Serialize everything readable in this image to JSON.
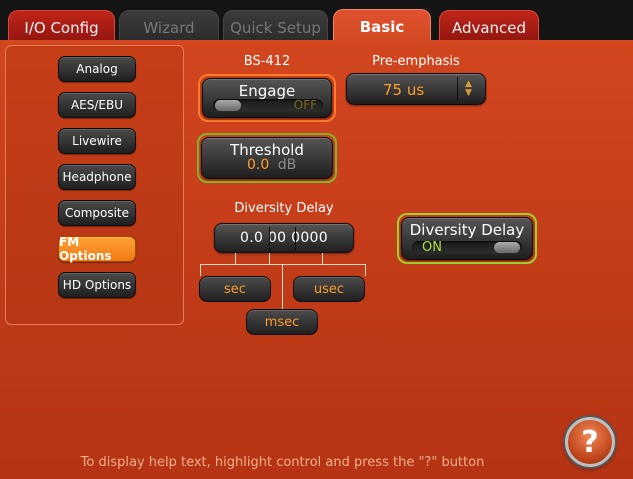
{
  "tabs": [
    {
      "label": "I/O Config",
      "state": "normal"
    },
    {
      "label": "Wizard",
      "state": "disabled"
    },
    {
      "label": "Quick Setup",
      "state": "disabled"
    },
    {
      "label": "Basic",
      "state": "active"
    },
    {
      "label": "Advanced",
      "state": "normal"
    }
  ],
  "sidebar": {
    "items": [
      {
        "label": "Analog"
      },
      {
        "label": "AES/EBU"
      },
      {
        "label": "Livewire"
      },
      {
        "label": "Headphone"
      },
      {
        "label": "Composite"
      },
      {
        "label": "FM Options",
        "selected": true
      },
      {
        "label": "HD Options"
      }
    ]
  },
  "bs412": {
    "section_label": "BS-412",
    "engage_title": "Engage",
    "engage_state": "OFF",
    "threshold_title": "Threshold",
    "threshold_value": "0.0",
    "threshold_unit": "dB"
  },
  "preemphasis": {
    "label": "Pre-emphasis",
    "value": "75 us"
  },
  "diversity": {
    "section_label": "Diversity Delay",
    "seconds": "0.0",
    "milliseconds": "00",
    "microseconds": "0000",
    "sec_label": "sec",
    "usec_label": "usec",
    "msec_label": "msec",
    "toggle_title": "Diversity Delay",
    "toggle_state": "ON"
  },
  "help": {
    "button_glyph": "?",
    "hint": "To display help text, highlight control and press the \"?\" button"
  },
  "colors": {
    "accent_orange": "#ff9a2a",
    "panel_red": "#c8401a",
    "highlight_green": "#9ed12f"
  }
}
